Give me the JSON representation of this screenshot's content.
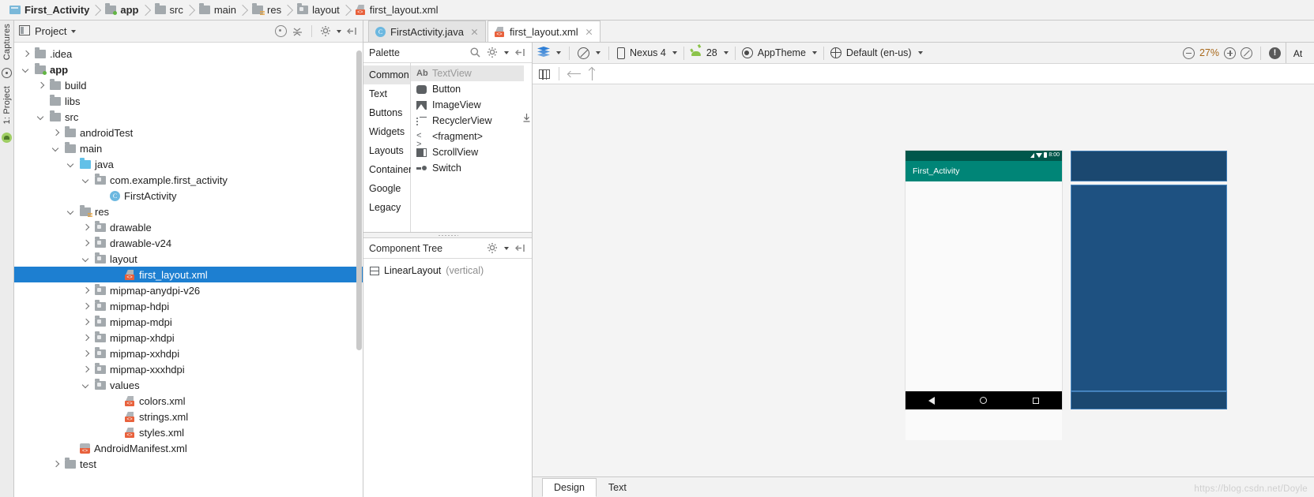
{
  "breadcrumb": [
    {
      "label": "First_Activity",
      "icon": "module-icon",
      "bold": true
    },
    {
      "label": "app",
      "icon": "module-folder-icon",
      "bold": true
    },
    {
      "label": "src",
      "icon": "folder-icon",
      "bold": false
    },
    {
      "label": "main",
      "icon": "folder-icon",
      "bold": false
    },
    {
      "label": "res",
      "icon": "res-folder-icon",
      "bold": false
    },
    {
      "label": "layout",
      "icon": "folder-icon",
      "bold": false
    },
    {
      "label": "first_layout.xml",
      "icon": "xml-file-icon",
      "bold": false
    }
  ],
  "left_rail": {
    "captures_label": "Captures",
    "project_label": "1: Project"
  },
  "project_panel": {
    "title": "Project",
    "tree": [
      {
        "label": ".idea",
        "depth": 1,
        "arrow": "right",
        "icon": "folder"
      },
      {
        "label": "app",
        "depth": 1,
        "arrow": "down",
        "icon": "module",
        "bold": true
      },
      {
        "label": "build",
        "depth": 2,
        "arrow": "right",
        "icon": "folder"
      },
      {
        "label": "libs",
        "depth": 2,
        "arrow": "none",
        "icon": "folder"
      },
      {
        "label": "src",
        "depth": 2,
        "arrow": "down",
        "icon": "folder"
      },
      {
        "label": "androidTest",
        "depth": 3,
        "arrow": "right",
        "icon": "folder"
      },
      {
        "label": "main",
        "depth": 3,
        "arrow": "down",
        "icon": "folder"
      },
      {
        "label": "java",
        "depth": 4,
        "arrow": "down",
        "icon": "folder-blue"
      },
      {
        "label": "com.example.first_activity",
        "depth": 5,
        "arrow": "down",
        "icon": "package"
      },
      {
        "label": "FirstActivity",
        "depth": 6,
        "arrow": "none",
        "icon": "class"
      },
      {
        "label": "res",
        "depth": 4,
        "arrow": "down",
        "icon": "res"
      },
      {
        "label": "drawable",
        "depth": 5,
        "arrow": "right",
        "icon": "package"
      },
      {
        "label": "drawable-v24",
        "depth": 5,
        "arrow": "right",
        "icon": "package"
      },
      {
        "label": "layout",
        "depth": 5,
        "arrow": "down",
        "icon": "package"
      },
      {
        "label": "first_layout.xml",
        "depth": 7,
        "arrow": "none",
        "icon": "xml",
        "selected": true
      },
      {
        "label": "mipmap-anydpi-v26",
        "depth": 5,
        "arrow": "right",
        "icon": "package"
      },
      {
        "label": "mipmap-hdpi",
        "depth": 5,
        "arrow": "right",
        "icon": "package"
      },
      {
        "label": "mipmap-mdpi",
        "depth": 5,
        "arrow": "right",
        "icon": "package"
      },
      {
        "label": "mipmap-xhdpi",
        "depth": 5,
        "arrow": "right",
        "icon": "package"
      },
      {
        "label": "mipmap-xxhdpi",
        "depth": 5,
        "arrow": "right",
        "icon": "package"
      },
      {
        "label": "mipmap-xxxhdpi",
        "depth": 5,
        "arrow": "right",
        "icon": "package"
      },
      {
        "label": "values",
        "depth": 5,
        "arrow": "down",
        "icon": "package"
      },
      {
        "label": "colors.xml",
        "depth": 7,
        "arrow": "none",
        "icon": "xml"
      },
      {
        "label": "strings.xml",
        "depth": 7,
        "arrow": "none",
        "icon": "xml"
      },
      {
        "label": "styles.xml",
        "depth": 7,
        "arrow": "none",
        "icon": "xml"
      },
      {
        "label": "AndroidManifest.xml",
        "depth": 4,
        "arrow": "none",
        "icon": "manifest"
      },
      {
        "label": "test",
        "depth": 3,
        "arrow": "right",
        "icon": "folder"
      }
    ]
  },
  "editor_tabs": [
    {
      "label": "FirstActivity.java",
      "icon": "java-class-icon",
      "active": false
    },
    {
      "label": "first_layout.xml",
      "icon": "xml-file-icon",
      "active": true
    }
  ],
  "palette": {
    "title": "Palette",
    "categories": [
      "Common",
      "Text",
      "Buttons",
      "Widgets",
      "Layouts",
      "Containers",
      "Google",
      "Legacy"
    ],
    "active_category": "Common",
    "items": [
      {
        "label": "TextView",
        "icon": "textview-icon",
        "active": true
      },
      {
        "label": "Button",
        "icon": "button-icon",
        "active": false
      },
      {
        "label": "ImageView",
        "icon": "imageview-icon",
        "active": false
      },
      {
        "label": "RecyclerView",
        "icon": "recyclerview-icon",
        "active": false
      },
      {
        "label": "<fragment>",
        "icon": "fragment-icon",
        "active": false
      },
      {
        "label": "ScrollView",
        "icon": "scrollview-icon",
        "active": false
      },
      {
        "label": "Switch",
        "icon": "switch-icon",
        "active": false
      }
    ]
  },
  "component_tree": {
    "title": "Component Tree",
    "nodes": [
      {
        "label": "LinearLayout",
        "qualifier": "(vertical)",
        "icon": "linearlayout-icon"
      }
    ]
  },
  "design_toolbar": {
    "device": "Nexus 4",
    "api_level": "28",
    "theme": "AppTheme",
    "locale": "Default (en-us)",
    "zoom": "27%",
    "attributes_tab": "At"
  },
  "preview": {
    "app_bar_title": "First_Activity",
    "status_clock": "8:00",
    "status_colors": {
      "status_bar": "#00574b",
      "action_bar": "#008577"
    },
    "blueprint_colors": {
      "fill": "#1e5181",
      "stroke": "#4a8ac4"
    }
  },
  "bottom_tabs": [
    {
      "label": "Design",
      "active": true
    },
    {
      "label": "Text",
      "active": false
    }
  ],
  "watermark": "https://blog.csdn.net/Doyle"
}
